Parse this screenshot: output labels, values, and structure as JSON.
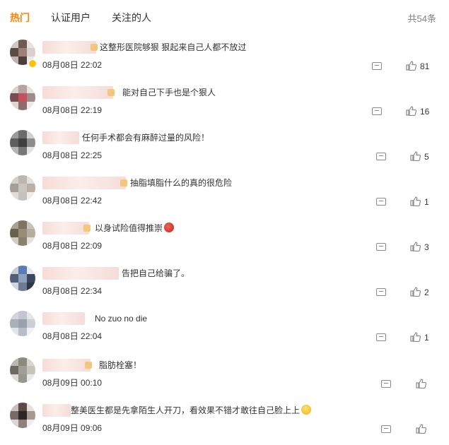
{
  "tabs": [
    {
      "label": "热门",
      "active": true
    },
    {
      "label": "认证用户",
      "active": false
    },
    {
      "label": "关注的人",
      "active": false
    }
  ],
  "total_label": "共54条",
  "colors": {
    "accent": "#ff8200",
    "text": "#333333",
    "muted": "#808080",
    "icon": "#8a8a8a"
  },
  "comments": [
    {
      "text": "这整形医院够狠 狠起来自己人都不放过",
      "time": "08月08日 22:02",
      "likes": "81"
    },
    {
      "text": "能对自己下手也是个狠人",
      "time": "08月08日 22:19",
      "likes": "16"
    },
    {
      "text": "任何手术都会有麻醉过量的风险！",
      "time": "08月08日 22:25",
      "likes": "5"
    },
    {
      "text": "抽脂填脂什么的真的很危险",
      "time": "08月08日 22:42",
      "likes": "1"
    },
    {
      "text": "以身试险值得推崇",
      "time": "08月08日 22:09",
      "likes": "3"
    },
    {
      "text": "告把自己给骗了。",
      "time": "08月08日 22:34",
      "likes": "2"
    },
    {
      "text": "No zuo no die",
      "time": "08月08日 22:04",
      "likes": "1"
    },
    {
      "text": "脂肪栓塞！",
      "time": "08月09日 00:10",
      "likes": ""
    },
    {
      "text": "整美医生都是先拿陌生人开刀，看效果不错才敢往自己脸上上",
      "time": "08月09日 09:06",
      "likes": ""
    }
  ]
}
